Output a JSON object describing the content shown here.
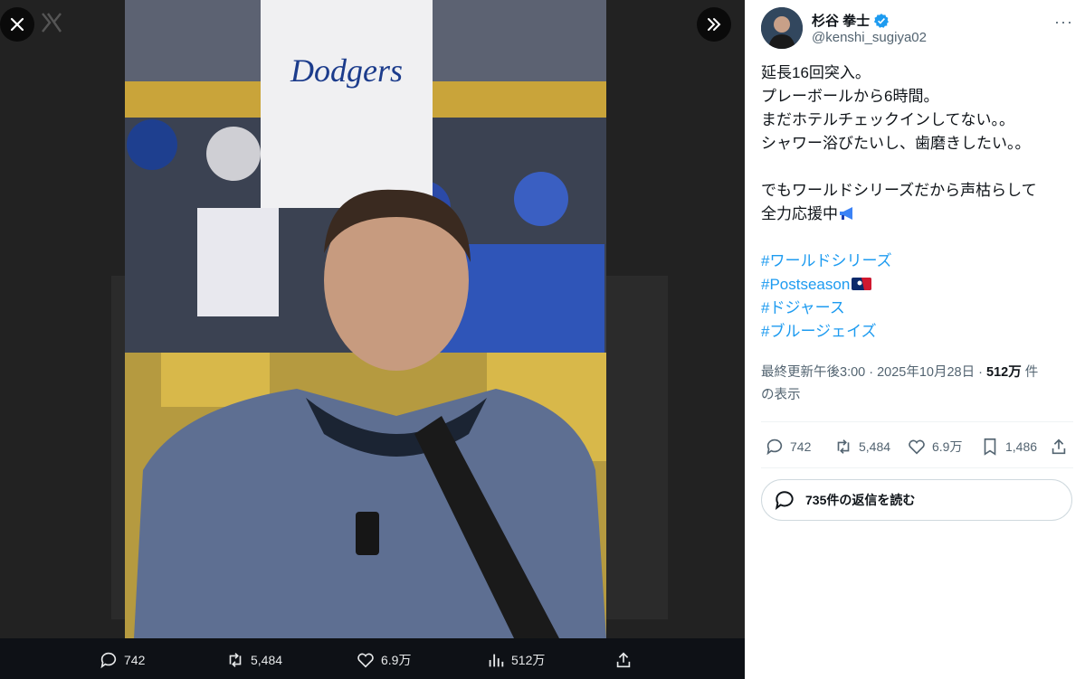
{
  "viewer": {
    "close_icon": "close-icon",
    "logo_icon": "x-logo-icon",
    "expand_icon": "double-chevron-right-icon",
    "photo_alt": "",
    "bottom_actions": {
      "replies": "742",
      "retweets": "5,484",
      "likes": "6.9万",
      "views": "512万"
    }
  },
  "tweet": {
    "author_name": "杉谷 拳士",
    "handle": "@kenshi_sugiya02",
    "verified_icon": "verified-badge-icon",
    "text_lines": [
      "延長16回突入。",
      "プレーボールから6時間。",
      "まだホテルチェックインしてない。。",
      "シャワー浴びたいし、歯磨きしたい。。",
      "",
      "でもワールドシリーズだから声枯らして",
      "全力応援中"
    ],
    "hashtags": [
      "#ワールドシリーズ",
      "#Postseason",
      "#ドジャース",
      "#ブルージェイズ"
    ],
    "timestamp": "最終更新午後3:00 · 2025年10月28日 · ",
    "views_count": "512万",
    "views_label": " 件",
    "views_label2": "の表示",
    "actions": {
      "replies": "742",
      "retweets": "5,484",
      "likes": "6.9万",
      "bookmarks": "1,486"
    },
    "read_replies": "735件の返信を読む"
  },
  "colors": {
    "accent": "#1d9bf0",
    "muted": "#536471"
  }
}
